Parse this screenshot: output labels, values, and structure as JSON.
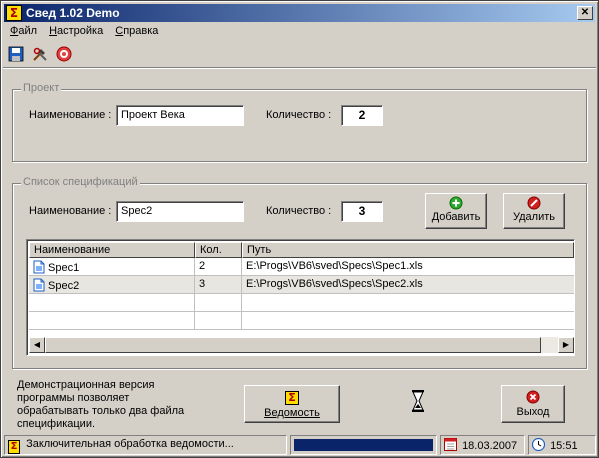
{
  "window": {
    "title": "Свед 1.02 Demo",
    "close_glyph": "✕",
    "app_icon_glyph": "Σ"
  },
  "menu": [
    {
      "label": "Файл",
      "accel": "Ф",
      "rest": "айл"
    },
    {
      "label": "Настройка",
      "accel": "Н",
      "rest": "астройка"
    },
    {
      "label": "Справка",
      "accel": "С",
      "rest": "правка"
    }
  ],
  "toolbar": {
    "icons": [
      "save-icon",
      "tools-icon",
      "help-icon"
    ]
  },
  "project": {
    "legend": "Проект",
    "name_label": "Наименование :",
    "name_value": "Проект Века",
    "qty_label": "Количество :",
    "qty_value": "2"
  },
  "specs": {
    "legend": "Список спецификаций",
    "name_label": "Наименование :",
    "name_value": "Spec2",
    "qty_label": "Количество :",
    "qty_value": "3",
    "add_button": "Добавить",
    "delete_button": "Удалить",
    "columns": [
      "Наименование",
      "Кол.",
      "Путь"
    ],
    "rows": [
      {
        "name": "Spec1",
        "qty": "2",
        "path": "E:\\Progs\\VB6\\sved\\Specs\\Spec1.xls"
      },
      {
        "name": "Spec2",
        "qty": "3",
        "path": "E:\\Progs\\VB6\\sved\\Specs\\Spec2.xls"
      }
    ]
  },
  "note": "Демонстрационная версия программы позволяет обрабатывать только два файла спецификации.",
  "buttons": {
    "report": "Ведомость",
    "exit": "Выход"
  },
  "status": {
    "text": "Заключительная обработка ведомости...",
    "progress_fraction": 1.0,
    "date": "18.03.2007",
    "time": "15:51"
  },
  "colors": {
    "titlebar_start": "#0a246a",
    "titlebar_end": "#a6caf0",
    "progress": "#0a246a",
    "add_icon": "#2eaa2e",
    "delete_icon": "#d02020"
  }
}
